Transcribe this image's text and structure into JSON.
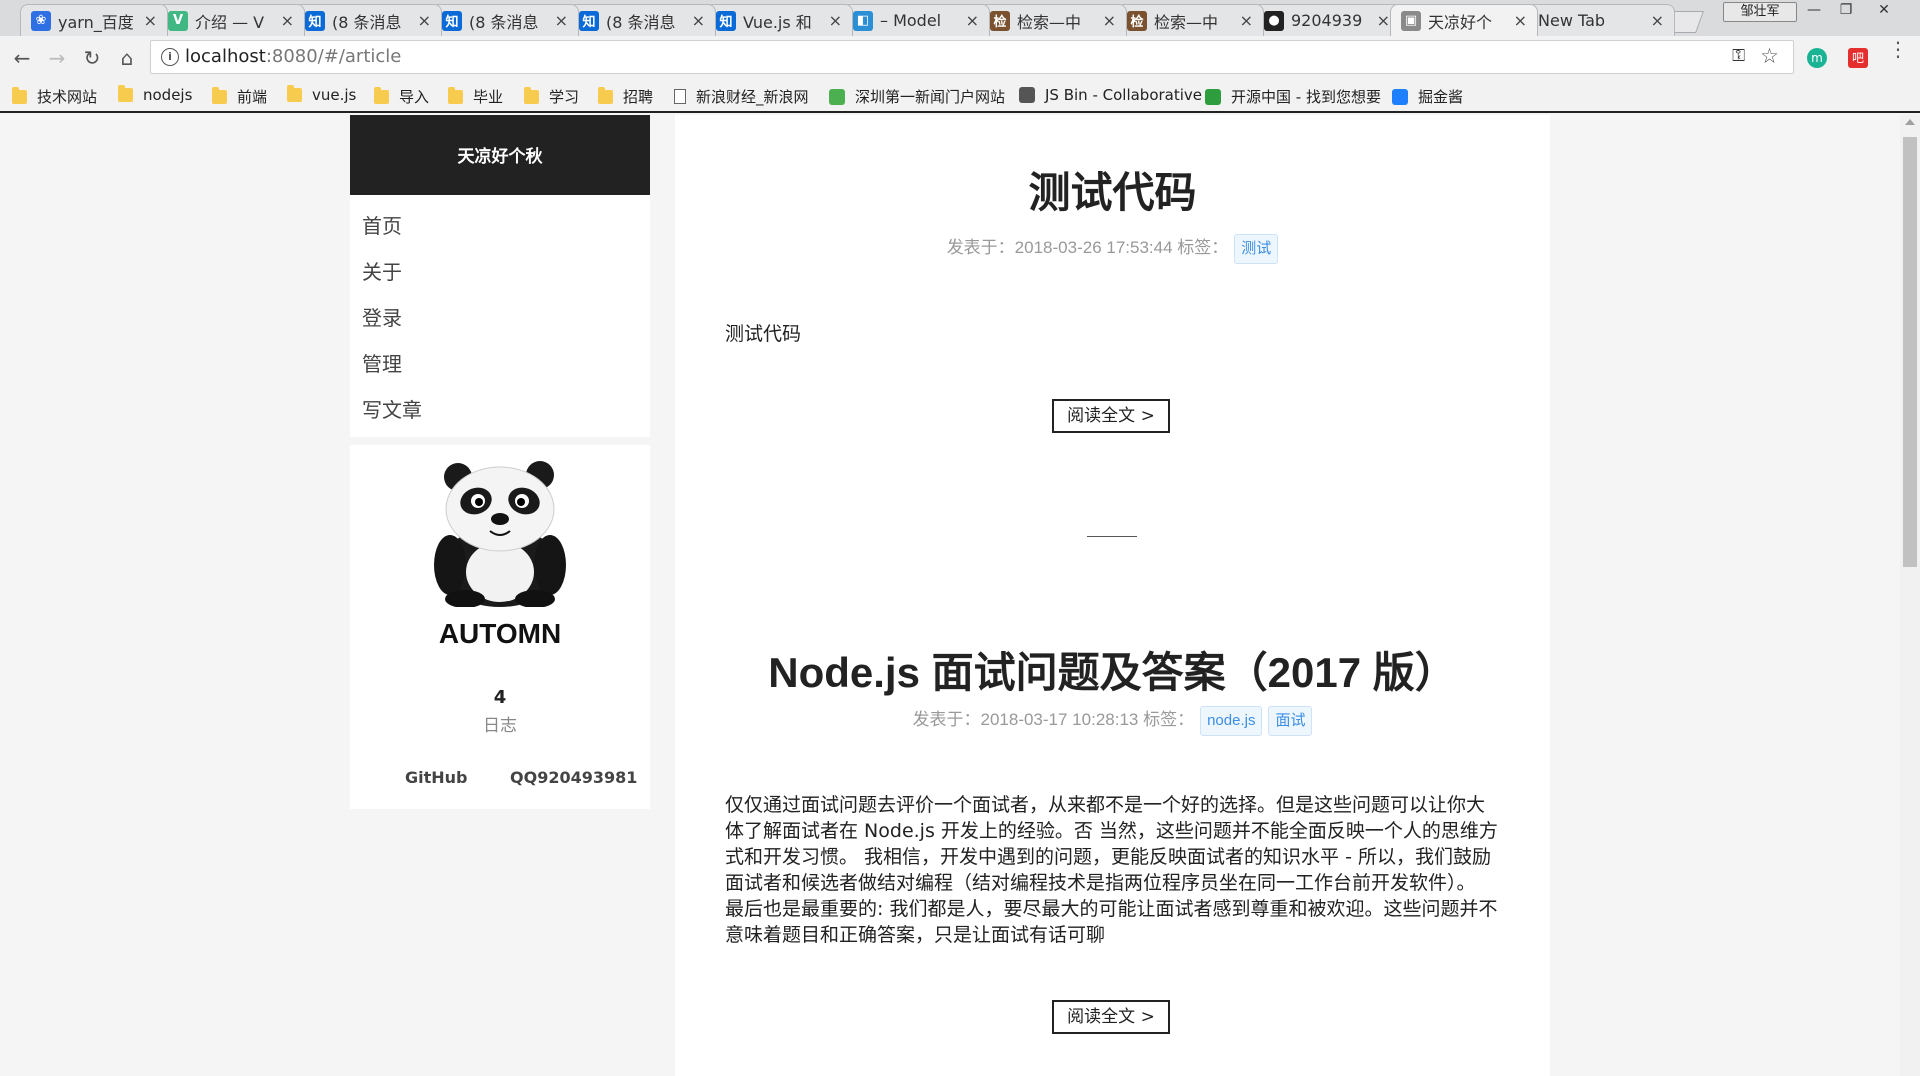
{
  "browser": {
    "tabs": [
      {
        "label": "yarn_百度",
        "icon_char": "❀",
        "icon_color": "#2f6fe4",
        "active": false
      },
      {
        "label": "介绍 — V",
        "icon_char": "V",
        "icon_color": "#41b883",
        "active": false
      },
      {
        "label": "(8 条消息",
        "icon_char": "知",
        "icon_color": "#0a6ad8",
        "active": false
      },
      {
        "label": "(8 条消息",
        "icon_char": "知",
        "icon_color": "#0a6ad8",
        "active": false
      },
      {
        "label": "(8 条消息",
        "icon_char": "知",
        "icon_color": "#0a6ad8",
        "active": false
      },
      {
        "label": "Vue.js 和",
        "icon_char": "知",
        "icon_color": "#0a6ad8",
        "active": false
      },
      {
        "label": "– Model",
        "icon_char": "◧",
        "icon_color": "#2b8fd6",
        "active": false
      },
      {
        "label": "检索—中",
        "icon_char": "检",
        "icon_color": "#7a5230",
        "active": false
      },
      {
        "label": "检索—中",
        "icon_char": "检",
        "icon_color": "#7a5230",
        "active": false
      },
      {
        "label": "9204939",
        "icon_char": "●",
        "icon_color": "#222222",
        "active": false
      },
      {
        "label": "天凉好个",
        "icon_char": "▣",
        "icon_color": "#8a8a8a",
        "active": true
      },
      {
        "label": "New Tab",
        "icon_char": "",
        "icon_color": "",
        "active": false
      }
    ],
    "user_badge": "邹壮军",
    "window_buttons": [
      "—",
      "❐",
      "✕"
    ],
    "close_glyph": "×",
    "nav_buttons": {
      "back": "←",
      "forward": "→",
      "reload": "↻",
      "home": "⌂"
    },
    "url": {
      "host": "localhost",
      "rest": ":8080/#/article"
    },
    "omnibox_icons": {
      "info": "i",
      "key": "⚿",
      "star": "☆"
    },
    "extensions": [
      {
        "char": "m",
        "color": "#1ab394"
      },
      {
        "char": "吧",
        "color": "#e52e2e"
      }
    ],
    "menu_glyph": "⋮",
    "bookmarks": [
      {
        "label": "技术网站",
        "type": "folder"
      },
      {
        "label": "nodejs",
        "type": "folder"
      },
      {
        "label": "前端",
        "type": "folder"
      },
      {
        "label": "vue.js",
        "type": "folder"
      },
      {
        "label": "导入",
        "type": "folder"
      },
      {
        "label": "毕业",
        "type": "folder"
      },
      {
        "label": "学习",
        "type": "folder"
      },
      {
        "label": "招聘",
        "type": "folder"
      },
      {
        "label": "新浪财经_新浪网",
        "type": "page"
      },
      {
        "label": "深圳第一新闻门户网站",
        "type": "fav",
        "color": "#4caf50"
      },
      {
        "label": "JS Bin - Collaborative",
        "type": "fav",
        "color": "#555555"
      },
      {
        "label": "开源中国 - 找到您想要",
        "type": "fav",
        "color": "#2e9d3d"
      },
      {
        "label": "掘金酱",
        "type": "fav",
        "color": "#1e80ff"
      }
    ]
  },
  "site": {
    "brand": "天凉好个秋",
    "nav": [
      "首页",
      "关于",
      "登录",
      "管理",
      "写文章"
    ],
    "profile": {
      "name": "AUTOMN",
      "post_count": "4",
      "post_count_label": "日志",
      "links": [
        "GitHub",
        "QQ920493981"
      ]
    }
  },
  "posts": [
    {
      "title": "测试代码",
      "meta": "发表于：2018-03-26 17:53:44 标签：",
      "tags": [
        "测试"
      ],
      "excerpt": "测试代码",
      "read_more": "阅读全文 >"
    },
    {
      "title": "Node.js 面试问题及答案（2017 版）",
      "meta": "发表于：2018-03-17 10:28:13 标签：",
      "tags": [
        "node.js",
        "面试"
      ],
      "excerpt": "仅仅通过面试问题去评价一个面试者，从来都不是一个好的选择。但是这些问题可以让你大体了解面试者在 Node.js 开发上的经验。否 当然，这些问题并不能全面反映一个人的思维方式和开发习惯。 我相信，开发中遇到的问题，更能反映面试者的知识水平 - 所以，我们鼓励面试者和候选者做结对编程（结对编程技术是指两位程序员坐在同一工作台前开发软件）。 最后也是最重要的: 我们都是人，要尽最大的可能让面试者感到尊重和被欢迎。这些问题并不意味着题目和正确答案，只是让面试有话可聊",
      "read_more": "阅读全文 >"
    }
  ]
}
